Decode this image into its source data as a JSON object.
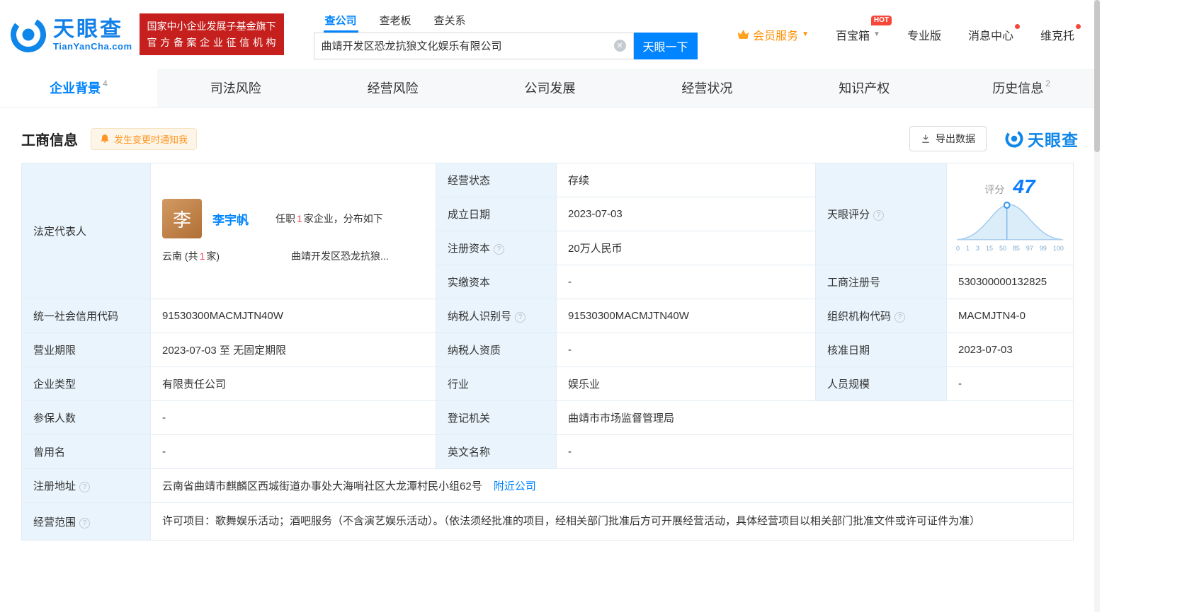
{
  "colors": {
    "accent_blue": "#0084ff",
    "badge_red": "#c5201d",
    "vip_orange": "#ff9000",
    "hot_red": "#f5483b",
    "count_red": "#f24957",
    "label_cell_bg": "#e9f4fc"
  },
  "header": {
    "logo_title": "天眼查",
    "logo_subtitle": "TianYanCha.com",
    "cert_line1": "国家中小企业发展子基金旗下",
    "cert_line2": "官方备案企业征信机构",
    "search": {
      "tabs": [
        "查公司",
        "查老板",
        "查关系"
      ],
      "value": "曲靖开发区恐龙抗狼文化娱乐有限公司",
      "button": "天眼一下"
    },
    "menu": {
      "vip": "会员服务",
      "toolbox": "百宝箱",
      "toolbox_badge": "HOT",
      "pro": "专业版",
      "messages": "消息中心",
      "user": "维克托"
    }
  },
  "nav_tabs": [
    {
      "label": "企业背景",
      "count": "4"
    },
    {
      "label": "司法风险"
    },
    {
      "label": "经营风险"
    },
    {
      "label": "公司发展"
    },
    {
      "label": "经营状况"
    },
    {
      "label": "知识产权"
    },
    {
      "label": "历史信息",
      "count": "2"
    }
  ],
  "section": {
    "title": "工商信息",
    "notify_button": "发生变更时通知我",
    "export_button": "导出数据",
    "brand": "天眼查"
  },
  "legal_rep": {
    "label": "法定代表人",
    "avatar_char": "李",
    "name": "李宇帆",
    "role_prefix": "任职",
    "role_count": "1",
    "role_suffix": "家企业，分布如下",
    "region": "云南",
    "region_paren_prefix": "(共",
    "region_count": "1",
    "region_paren_suffix": "家)",
    "company_short": "曲靖开发区恐龙抗狼..."
  },
  "score": {
    "label": "天眼评分",
    "score_caption": "评分",
    "value": "47",
    "ticks": [
      "0",
      "1",
      "3",
      "15",
      "50",
      "85",
      "97",
      "99",
      "100"
    ]
  },
  "fields": {
    "status_label": "经营状态",
    "status_value": "存续",
    "est_date_label": "成立日期",
    "est_date_value": "2023-07-03",
    "reg_capital_label": "注册资本",
    "reg_capital_value": "20万人民币",
    "paid_capital_label": "实缴资本",
    "paid_capital_value": "-",
    "reg_no_label": "工商注册号",
    "reg_no_value": "530300000132825",
    "credit_code_label": "统一社会信用代码",
    "credit_code_value": "91530300MACMJTN40W",
    "taxpayer_id_label": "纳税人识别号",
    "taxpayer_id_value": "91530300MACMJTN40W",
    "org_code_label": "组织机构代码",
    "org_code_value": "MACMJTN4-0",
    "term_label": "营业期限",
    "term_value": "2023-07-03 至 无固定期限",
    "taxpayer_qual_label": "纳税人资质",
    "taxpayer_qual_value": "-",
    "approval_date_label": "核准日期",
    "approval_date_value": "2023-07-03",
    "company_type_label": "企业类型",
    "company_type_value": "有限责任公司",
    "industry_label": "行业",
    "industry_value": "娱乐业",
    "staff_size_label": "人员规模",
    "staff_size_value": "-",
    "insured_label": "参保人数",
    "insured_value": "-",
    "registry_label": "登记机关",
    "registry_value": "曲靖市市场监督管理局",
    "former_name_label": "曾用名",
    "former_name_value": "-",
    "english_name_label": "英文名称",
    "english_name_value": "-",
    "address_label": "注册地址",
    "address_value": "云南省曲靖市麒麟区西城街道办事处大海哨社区大龙潭村民小组62号",
    "nearby_link": "附近公司",
    "scope_label": "经营范围",
    "scope_value": "许可项目：歌舞娱乐活动；酒吧服务（不含演艺娱乐活动）。（依法须经批准的项目，经相关部门批准后方可开展经营活动，具体经营项目以相关部门批准文件或许可证件为准）"
  }
}
